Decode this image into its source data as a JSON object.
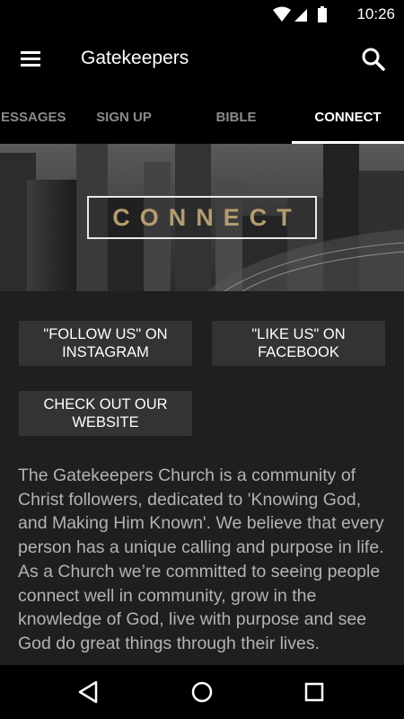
{
  "status_bar": {
    "time": "10:26",
    "icons": [
      "wifi-icon",
      "signal-icon",
      "battery-icon"
    ]
  },
  "app_bar": {
    "title": "Gatekeepers",
    "menu_icon": "menu-icon",
    "search_icon": "search-icon"
  },
  "tabs": [
    {
      "label": "MESSAGES",
      "active": false
    },
    {
      "label": "SIGN UP",
      "active": false
    },
    {
      "label": "BIBLE",
      "active": false
    },
    {
      "label": "CONNECT",
      "active": true
    }
  ],
  "hero": {
    "banner_text": "CONNECT"
  },
  "buttons": {
    "instagram": "\"FOLLOW US\" ON INSTAGRAM",
    "facebook": "\"LIKE US\" ON FACEBOOK",
    "website": "CHECK OUT OUR WEBSITE"
  },
  "description": "The Gatekeepers Church is a community of Christ followers, dedicated to 'Knowing God, and Making Him Known'. We believe that every person has a unique calling and purpose in life. As a Church we’re committed to seeing people connect well in community, grow in the knowledge of God, live with purpose and see God do great things through their lives.",
  "nav_bar": {
    "icons": [
      "back-icon",
      "home-icon",
      "recents-icon"
    ]
  },
  "colors": {
    "accent_gold": "#b39c6f",
    "background": "#1f1f1f",
    "button": "#333333"
  }
}
